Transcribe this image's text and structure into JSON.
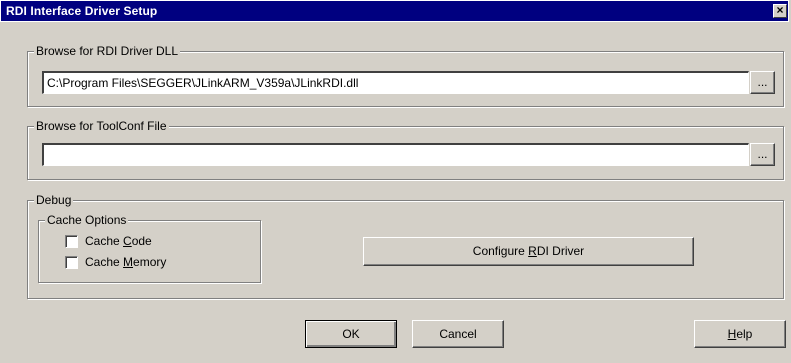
{
  "window": {
    "title": "RDI Interface Driver Setup",
    "close_glyph": "×"
  },
  "dll_group": {
    "legend": "Browse for RDI Driver DLL",
    "path_value": "C:\\Program Files\\SEGGER\\JLinkARM_V359a\\JLinkRDI.dll",
    "browse_label": "..."
  },
  "toolconf_group": {
    "legend": "Browse for ToolConf File",
    "path_value": "",
    "browse_label": "..."
  },
  "debug_group": {
    "legend": "Debug",
    "cache_options": {
      "legend": "Cache Options",
      "cache_code": {
        "pre": "Cache ",
        "accel": "C",
        "post": "ode",
        "checked": false
      },
      "cache_memory": {
        "pre": "Cache ",
        "accel": "M",
        "post": "emory",
        "checked": false
      }
    },
    "configure": {
      "pre": "Configure ",
      "accel": "R",
      "post": "DI Driver"
    }
  },
  "footer": {
    "ok_label": "OK",
    "cancel_label": "Cancel",
    "help": {
      "pre": "",
      "accel": "H",
      "post": "elp"
    }
  }
}
